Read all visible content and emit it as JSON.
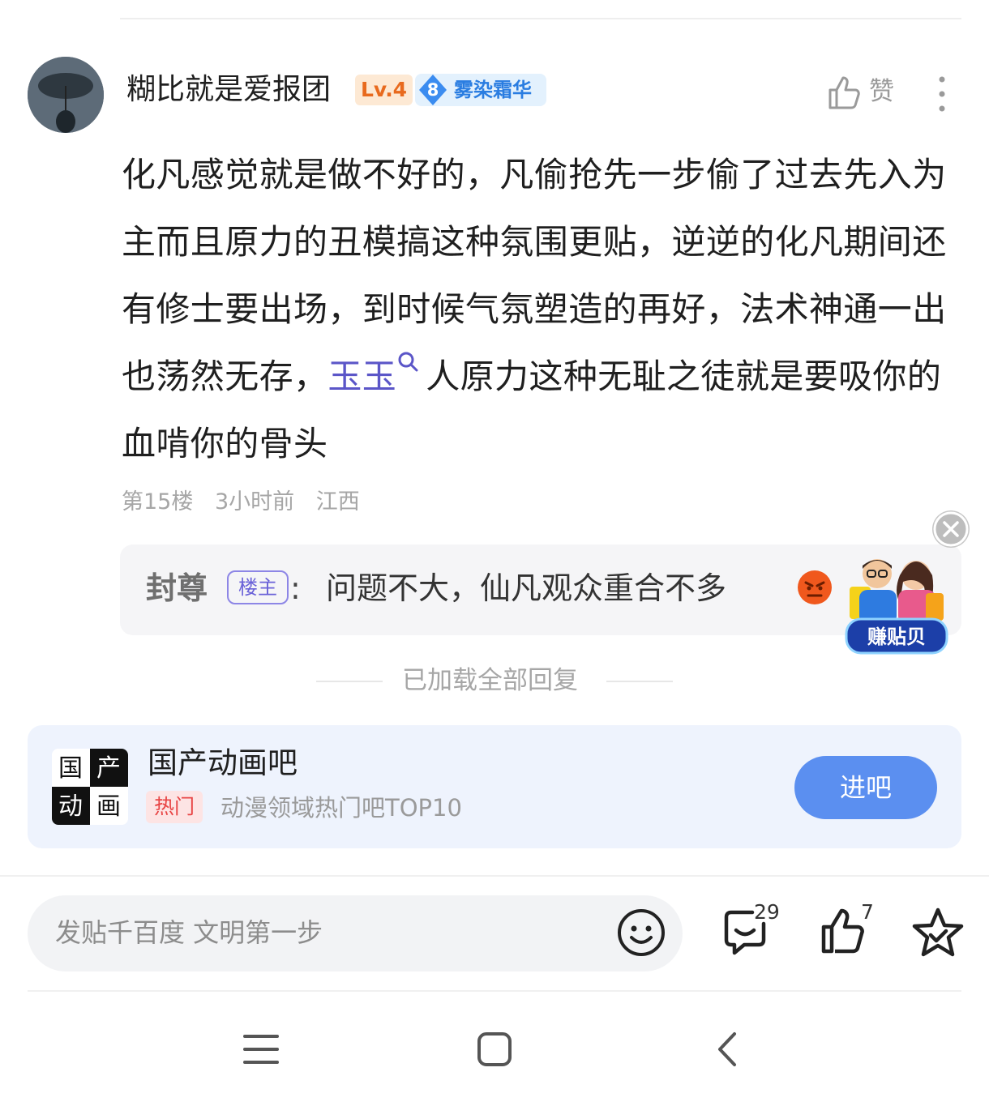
{
  "post": {
    "username": "糊比就是爱报团",
    "level": "Lv.4",
    "member_level": "8",
    "member_title": "雾染霜华",
    "like_label": "赞",
    "body_part1": "化凡感觉就是做不好的，凡偷抢先一步偷了过去先入为主而且原力的丑模搞这种氛围更贴，逆逆的化凡期间还有修士要出场，到时候气氛塑造的再好，法术神通一出也荡然无存，",
    "body_link": "玉玉",
    "body_part2": "人原力这种无耻之徒就是要吸你的血啃你的骨头",
    "floor": "第15楼",
    "time": "3小时前",
    "location": "江西"
  },
  "reply": {
    "author": "封尊",
    "host_tag": "楼主",
    "colon": ":",
    "text": "问题不大，仙凡观众重合不多"
  },
  "earn_widget_label": "赚贴贝",
  "loaded_text": "已加载全部回复",
  "bar_card": {
    "logo_chars": [
      "国",
      "产",
      "动",
      "画"
    ],
    "name": "国产动画吧",
    "hot_tag": "热门",
    "desc": "动漫领域热门吧TOP10",
    "enter_label": "进吧"
  },
  "bottom_bar": {
    "input_placeholder": "发贴千百度 文明第一步",
    "comment_count": "29",
    "like_count": "7"
  },
  "colors": {
    "accent_blue": "#5b8ff0",
    "link_purple": "#5b56c8",
    "hot_red": "#e84545",
    "level_orange": "#e86a1e"
  }
}
